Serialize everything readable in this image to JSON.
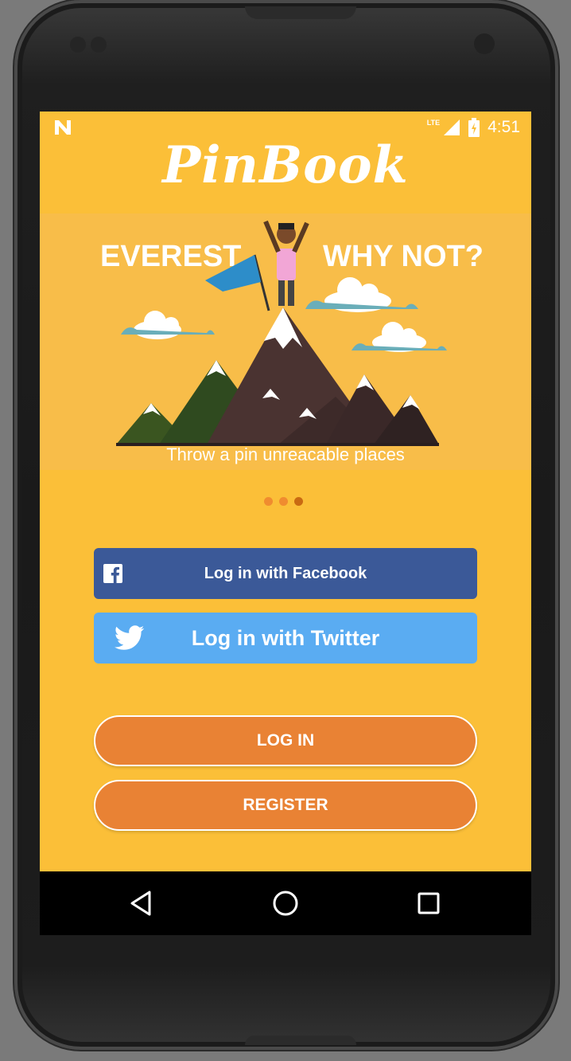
{
  "status_bar": {
    "network": "LTE",
    "time": "4:51"
  },
  "app": {
    "logo_text": "PinBook"
  },
  "hero": {
    "left_title": "EVEREST",
    "right_title": "WHY NOT?",
    "caption": "Throw a pin unreacable places"
  },
  "carousel": {
    "total": 3,
    "active_index": 2
  },
  "buttons": {
    "facebook": "Log in with Facebook",
    "twitter": "Log in with Twitter",
    "login": "LOG IN",
    "register": "REGISTER"
  },
  "colors": {
    "background": "#fbbf38",
    "facebook": "#3b5998",
    "twitter": "#5aacf2",
    "primary_button": "#e98234"
  },
  "icons": [
    "n-icon",
    "signal-icon",
    "battery-icon",
    "facebook-icon",
    "twitter-icon",
    "back-icon",
    "home-icon",
    "recents-icon"
  ]
}
